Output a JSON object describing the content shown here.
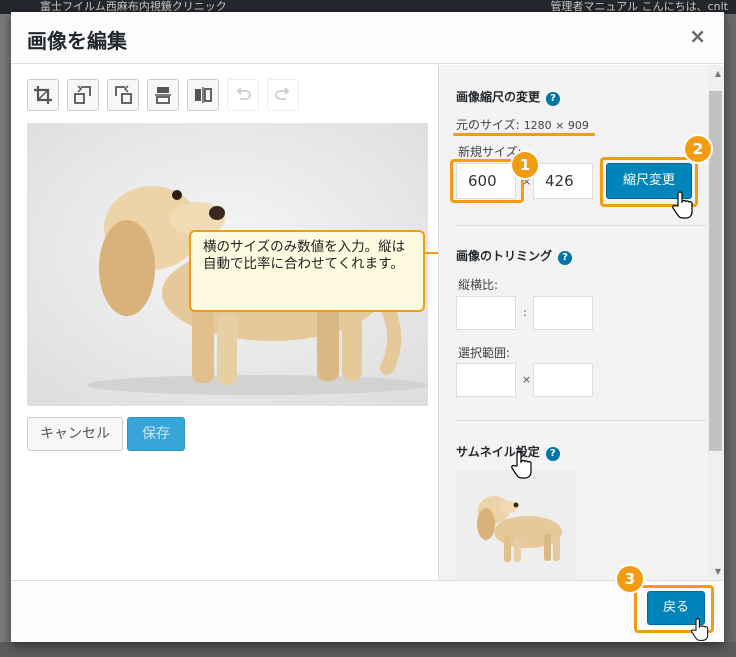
{
  "background": {
    "adminbar_text": "富士フイルム西麻布内視鏡クリニック",
    "adminbar_right": "管理者マニュアル こんにちは、cnlt"
  },
  "modal": {
    "title": "画像を編集",
    "close_label": "×"
  },
  "toolbar": {
    "tools": [
      {
        "name": "crop-icon",
        "enabled": true
      },
      {
        "name": "rotate-left-icon",
        "enabled": true
      },
      {
        "name": "rotate-right-icon",
        "enabled": true
      },
      {
        "name": "flip-vertical-icon",
        "enabled": true
      },
      {
        "name": "flip-horizontal-icon",
        "enabled": true
      },
      {
        "name": "undo-icon",
        "enabled": false
      },
      {
        "name": "redo-icon",
        "enabled": false
      }
    ]
  },
  "actions": {
    "cancel_label": "キャンセル",
    "save_label": "保存"
  },
  "callout": {
    "text": "横のサイズのみ数値を入力。縦は自動で比率に合わせてくれます。"
  },
  "scale": {
    "title": "画像縮尺の変更",
    "original_label": "元のサイズ:",
    "original_value": "1280 × 909",
    "new_size_label": "新規サイズ:",
    "width_value": "600",
    "height_value": "426",
    "separator": "×",
    "button_label": "縮尺変更"
  },
  "crop": {
    "title": "画像のトリミング",
    "ratio_label": "縦横比:",
    "ratio_separator": ":",
    "selection_label": "選択範囲:",
    "selection_separator": "×"
  },
  "thumbnail": {
    "title": "サムネイル設定"
  },
  "footer": {
    "back_label": "戻る"
  },
  "badges": [
    "1",
    "2",
    "3"
  ],
  "colors": {
    "accent": "#f39c12",
    "primary": "#0085ba",
    "help": "#0073aa"
  }
}
